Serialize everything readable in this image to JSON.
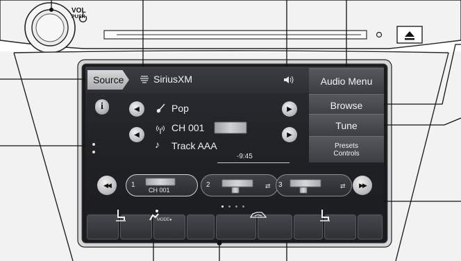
{
  "header": {
    "vol_label": "VOL",
    "push_label": "PUSH"
  },
  "screen": {
    "source_button": "Source",
    "source_name": "SiriusXM",
    "side_menu": {
      "audio_menu": "Audio Menu",
      "browse": "Browse",
      "tune": "Tune",
      "presets_line1": "Presets",
      "presets_line2": "Controls"
    },
    "info_label": "i",
    "now_playing": {
      "genre": "Pop",
      "channel": "CH 001",
      "track": "Track AAA",
      "time": "-9:45"
    },
    "presets": [
      {
        "number": "1",
        "label": "CH 001"
      },
      {
        "number": "2",
        "label": ""
      },
      {
        "number": "3",
        "label": ""
      }
    ],
    "page_indicator": {
      "count": 4,
      "active": 1
    }
  },
  "icons": {
    "siriusxm": "siriusxm-logo-icon",
    "speaker": "speaker-volume-icon",
    "genre": "guitar-icon",
    "channel": "antenna-signal-icon",
    "track": "music-note-icon",
    "shuffle": "shuffle-icon",
    "rewind": "rewind-icon",
    "forward": "fast-forward-icon",
    "eject": "eject-icon",
    "power": "power-icon"
  },
  "colors": {
    "screen_bg": "#202326",
    "button_gradient_top": "#55585d",
    "source_button": "#c4c5c7"
  }
}
